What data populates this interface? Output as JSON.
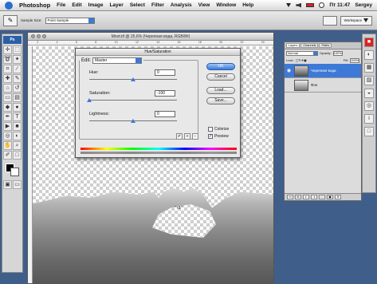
{
  "menubar": {
    "app": "Photoshop",
    "items": [
      "File",
      "Edit",
      "Image",
      "Layer",
      "Select",
      "Filter",
      "Analysis",
      "View",
      "Window",
      "Help"
    ],
    "clock": "Пт 11:47",
    "user": "Sergey"
  },
  "options": {
    "sample_label": "Sample Size:",
    "sample_value": "Point Sample",
    "workspace": "Workspace"
  },
  "document": {
    "title": "Mnot.tif @ 25,6% (Черепная вода, RGB/8#)",
    "ruler_marks": [
      "2",
      "4",
      "6",
      "8",
      "10",
      "12",
      "14",
      "16",
      "18",
      "20",
      "22",
      "24"
    ],
    "marquee_label": "“ιδ”"
  },
  "dialog": {
    "title": "Hue/Saturation",
    "edit_label": "Edit:",
    "edit_value": "Master",
    "hue_label": "Hue:",
    "hue_value": "0",
    "saturation_label": "Saturation:",
    "saturation_value": "-100",
    "lightness_label": "Lightness:",
    "lightness_value": "0",
    "ok": "OK",
    "cancel": "Cancel",
    "load": "Load...",
    "save": "Save...",
    "colorize": "Colorize",
    "preview": "Preview",
    "colorize_checked": false,
    "preview_checked": true,
    "hue_level": 0.5,
    "saturation_level": 0.0,
    "lightness_level": 0.5
  },
  "layers": {
    "tabs": [
      "Layers",
      "Channels",
      "Paths"
    ],
    "blend_mode": "Normal",
    "opacity_label": "Opacity:",
    "opacity_value": "100%",
    "lock_label": "Lock:",
    "fill_label": "Fill:",
    "fill_value": "100%",
    "items": [
      {
        "name": "Черепная вода",
        "selected": true
      },
      {
        "name": "Фон",
        "selected": false
      }
    ]
  },
  "colors": {
    "accent": "#3d7ad8",
    "desktop": "#3f5f8a"
  }
}
